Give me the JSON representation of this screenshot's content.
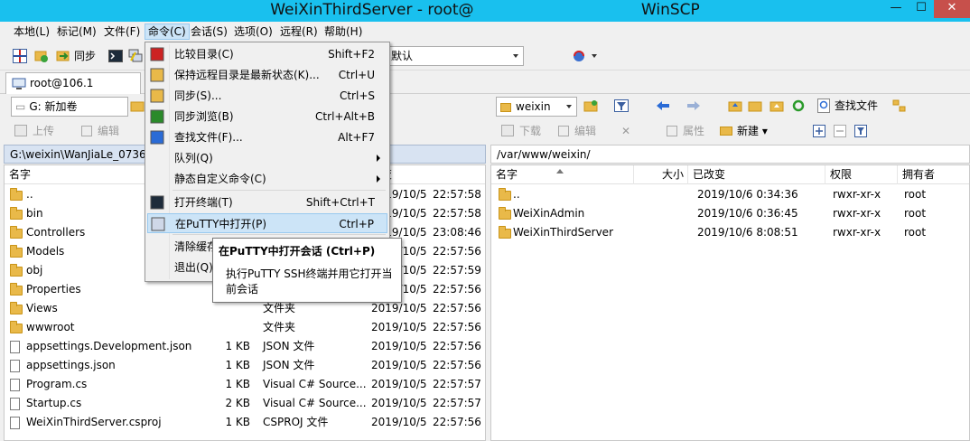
{
  "window": {
    "title_prefix": "WeiXinThirdServer - root@",
    "title_suffix": "WinSCP",
    "minimize": "—",
    "maximize": "☐",
    "close": "✕"
  },
  "menu": {
    "items": [
      "本地(L)",
      "标记(M)",
      "文件(F)",
      "命令(C)",
      "会话(S)",
      "选项(O)",
      "远程(R)",
      "帮助(H)"
    ]
  },
  "toolbar": {
    "sync_label": "同步",
    "profile_combo": "默认"
  },
  "session": {
    "tab_label": "root@106.1"
  },
  "left_pane": {
    "drive_combo": "G: 新加卷",
    "upload_label": "上传",
    "edit_label": "编辑",
    "path": "G:\\weixin\\WanJiaLe_0736_",
    "columns": [
      "名字",
      "",
      "",
      "改变"
    ],
    "rows": [
      {
        "name": "..",
        "size": "",
        "type": "",
        "date": "2019/10/5",
        "time": "22:57:58",
        "kind": "up"
      },
      {
        "name": "bin",
        "size": "",
        "type": "",
        "date": "2019/10/5",
        "time": "22:57:58",
        "kind": "folder"
      },
      {
        "name": "Controllers",
        "size": "",
        "type": "",
        "date": "2019/10/5",
        "time": "23:08:46",
        "kind": "folder"
      },
      {
        "name": "Models",
        "size": "",
        "type": "",
        "date": "2019/10/5",
        "time": "22:57:56",
        "kind": "folder"
      },
      {
        "name": "obj",
        "size": "",
        "type": "",
        "date": "2019/10/5",
        "time": "22:57:59",
        "kind": "folder"
      },
      {
        "name": "Properties",
        "size": "",
        "type": "",
        "date": "2019/10/5",
        "time": "22:57:56",
        "kind": "folder"
      },
      {
        "name": "Views",
        "size": "",
        "type": "文件夹",
        "date": "2019/10/5",
        "time": "22:57:56",
        "kind": "folder"
      },
      {
        "name": "wwwroot",
        "size": "",
        "type": "文件夹",
        "date": "2019/10/5",
        "time": "22:57:56",
        "kind": "folder"
      },
      {
        "name": "appsettings.Development.json",
        "size": "1 KB",
        "type": "JSON 文件",
        "date": "2019/10/5",
        "time": "22:57:56",
        "kind": "file"
      },
      {
        "name": "appsettings.json",
        "size": "1 KB",
        "type": "JSON 文件",
        "date": "2019/10/5",
        "time": "22:57:56",
        "kind": "file"
      },
      {
        "name": "Program.cs",
        "size": "1 KB",
        "type": "Visual C# Source...",
        "date": "2019/10/5",
        "time": "22:57:57",
        "kind": "file"
      },
      {
        "name": "Startup.cs",
        "size": "2 KB",
        "type": "Visual C# Source...",
        "date": "2019/10/5",
        "time": "22:57:57",
        "kind": "file"
      },
      {
        "name": "WeiXinThirdServer.csproj",
        "size": "1 KB",
        "type": "CSPROJ 文件",
        "date": "2019/10/5",
        "time": "22:57:56",
        "kind": "file"
      }
    ]
  },
  "right_pane": {
    "dir_combo": "weixin",
    "find_files_label": "查找文件",
    "download_label": "下载",
    "edit_label": "编辑",
    "properties_label": "属性",
    "new_label": "新建",
    "path": "/var/www/weixin/",
    "columns": [
      "名字",
      "大小",
      "已改变",
      "权限",
      "拥有者"
    ],
    "rows": [
      {
        "name": "..",
        "size": "",
        "changed": "2019/10/6 0:34:36",
        "rights": "rwxr-xr-x",
        "owner": "root",
        "kind": "up"
      },
      {
        "name": "WeiXinAdmin",
        "size": "",
        "changed": "2019/10/6 0:36:45",
        "rights": "rwxr-xr-x",
        "owner": "root",
        "kind": "folder"
      },
      {
        "name": "WeiXinThirdServer",
        "size": "",
        "changed": "2019/10/6 8:08:51",
        "rights": "rwxr-xr-x",
        "owner": "root",
        "kind": "folder"
      }
    ]
  },
  "command_menu": {
    "items": [
      {
        "label": "比较目录(C)",
        "shortcut": "Shift+F2",
        "icon": "compare-icon"
      },
      {
        "label": "保持远程目录是最新状态(K)...",
        "shortcut": "Ctrl+U",
        "icon": "keep-up-to-date-icon"
      },
      {
        "label": "同步(S)...",
        "shortcut": "Ctrl+S",
        "icon": "synchronize-icon"
      },
      {
        "label": "同步浏览(B)",
        "shortcut": "Ctrl+Alt+B",
        "icon": "sync-browse-icon"
      },
      {
        "label": "查找文件(F)...",
        "shortcut": "Alt+F7",
        "icon": "find-files-icon"
      },
      {
        "label": "队列(Q)",
        "shortcut": "",
        "icon": ""
      },
      {
        "label": "静态自定义命令(C)",
        "shortcut": "",
        "icon": ""
      },
      {
        "label": "打开终端(T)",
        "shortcut": "Shift+Ctrl+T",
        "icon": "terminal-icon"
      },
      {
        "label": "在PuTTY中打开(P)",
        "shortcut": "Ctrl+P",
        "icon": "putty-icon"
      },
      {
        "label": "清除缓存",
        "shortcut": "",
        "icon": ""
      },
      {
        "label": "退出(Q)",
        "shortcut": "",
        "icon": ""
      }
    ]
  },
  "tooltip": {
    "title": "在PuTTY中打开会话 (Ctrl+P)",
    "body": "执行PuTTY SSH终端并用它打开当前会话"
  }
}
